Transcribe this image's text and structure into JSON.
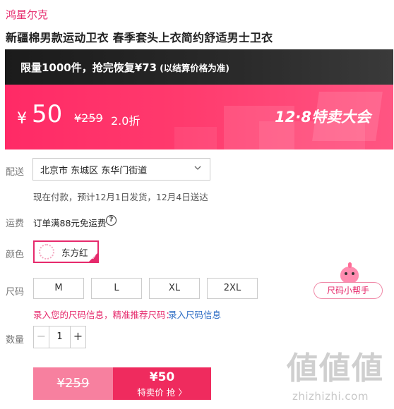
{
  "brand": "鸿星尔克",
  "product_title": "新疆棉男款运动卫衣 春季套头上衣简约舒适男士卫衣",
  "limit_banner": {
    "main": "限量1000件，抢完恢复¥73",
    "note": "(以结算价格为准)"
  },
  "price": {
    "currency": "¥",
    "current": "50",
    "original": "¥259",
    "discount": "2.0折",
    "event_label": "12·8特卖大会"
  },
  "delivery": {
    "label": "配送",
    "address": "北京市 东城区 东华门街道",
    "estimate": "现在付款，预计12月1日发货，12月4日送达"
  },
  "shipping": {
    "label": "运费",
    "text": "订单满88元免运费",
    "help_glyph": "?"
  },
  "color": {
    "label": "颜色",
    "selected": "东方红"
  },
  "size": {
    "label": "尺码",
    "options": [
      "M",
      "L",
      "XL",
      "2XL"
    ],
    "helper": "尺码小帮手",
    "recommend_text": "录入您的尺码信息，精准推荐尺码：",
    "recommend_link": "录入尺码信息"
  },
  "quantity": {
    "label": "数量",
    "value": "1",
    "minus": "−",
    "plus": "+"
  },
  "buy": {
    "original": "¥259",
    "price": "¥50",
    "action": "特卖价 抢 〉"
  },
  "watermark": {
    "logo": "値値値",
    "site": "zhizhizhi.com"
  },
  "colors": {
    "accent": "#e62a6c",
    "banner_start": "#ff2a66",
    "buy_button": "#ef2b5e",
    "buy_original": "#f7809f",
    "link": "#2d6dc4"
  }
}
